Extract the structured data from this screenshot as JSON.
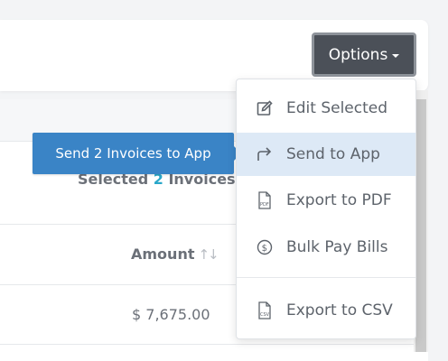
{
  "header": {
    "options_label": "Options"
  },
  "table": {
    "selected_prefix": "Selected",
    "selected_count": "2",
    "selected_suffix": "Invoices",
    "amount_header": "Amount",
    "sort_glyph": "↑↓",
    "rows": [
      {
        "amount": "$ 7,675.00"
      }
    ]
  },
  "tooltip": {
    "text": "Send 2 Invoices to App"
  },
  "menu": {
    "items": [
      {
        "label": "Edit Selected",
        "icon": "edit-icon"
      },
      {
        "label": "Send to App",
        "icon": "share-arrow-icon"
      },
      {
        "label": "Export to PDF",
        "icon": "pdf-file-icon"
      },
      {
        "label": "Bulk Pay Bills",
        "icon": "dollar-circle-icon"
      },
      {
        "label": "Export to CSV",
        "icon": "csv-file-icon"
      }
    ]
  },
  "colors": {
    "tooltip_bg": "#3a84c6",
    "active_item_bg": "#dde9f6",
    "count_accent": "#2aa7c9",
    "options_bg": "#4b5058"
  }
}
